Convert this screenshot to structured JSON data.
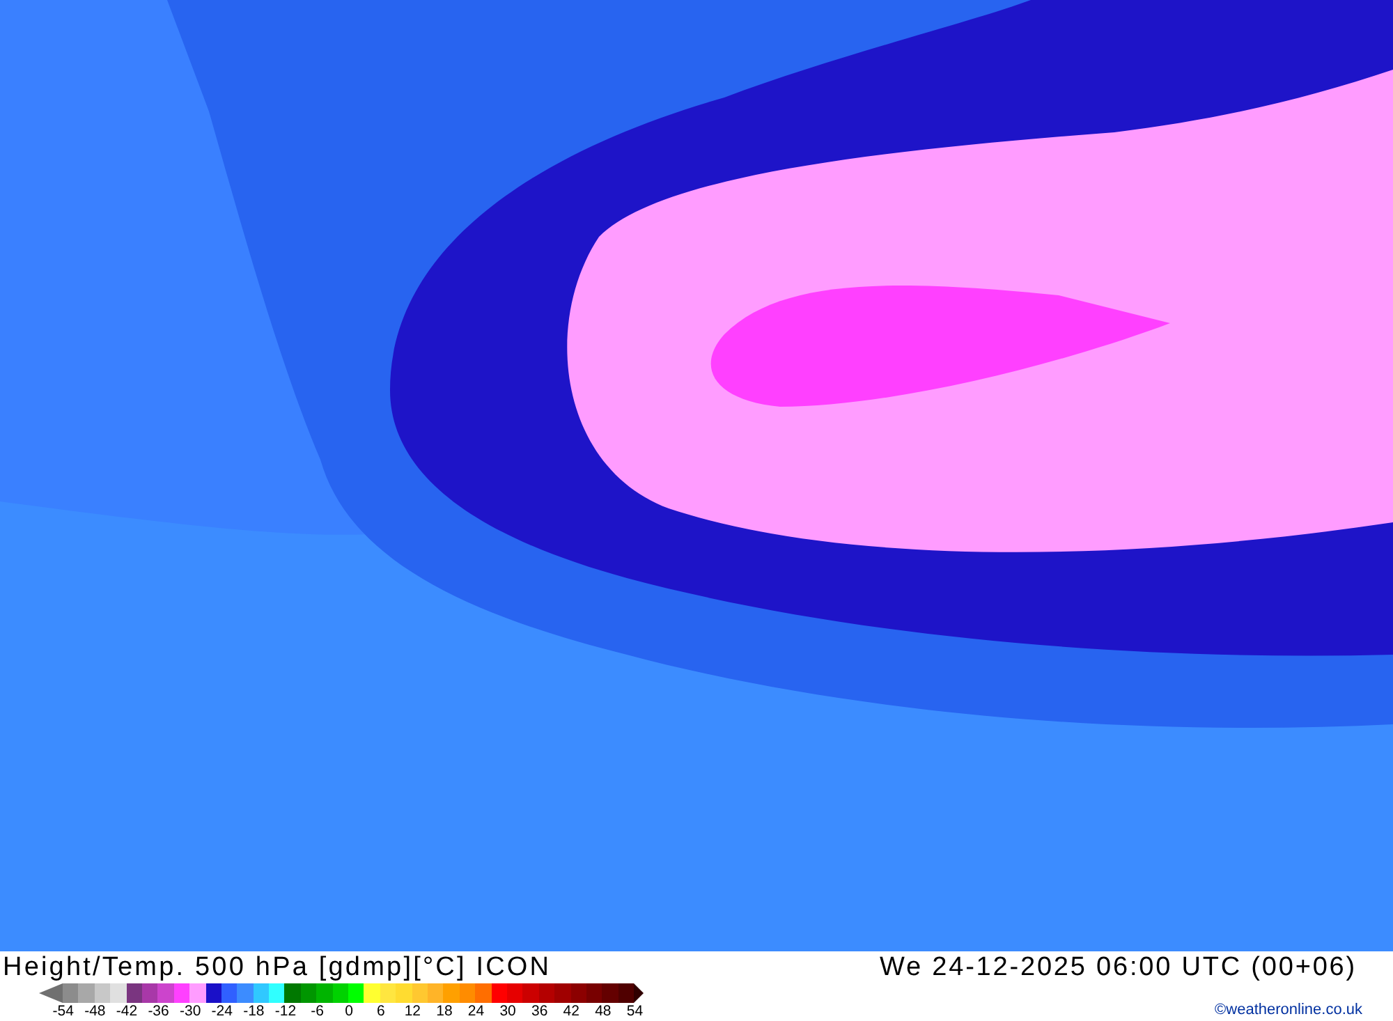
{
  "map": {
    "title": "Height/Temp. 500 hPa [gdmp][°C] ICON",
    "run": "We 24-12-2025 06:00 UTC (00+06)",
    "credit": "©weatheronline.co.uk"
  },
  "legend": {
    "swatches": [
      {
        "color": "#8c8c8c"
      },
      {
        "color": "#a8a8a8"
      },
      {
        "color": "#c8c8c8"
      },
      {
        "color": "#e0e0e0"
      },
      {
        "color": "#7a3580"
      },
      {
        "color": "#a838a8"
      },
      {
        "color": "#cc44cc"
      },
      {
        "color": "#ff40ff"
      },
      {
        "color": "#ff9cff"
      },
      {
        "color": "#1a10c8"
      },
      {
        "color": "#3060ff"
      },
      {
        "color": "#3c8cff"
      },
      {
        "color": "#30c8ff"
      },
      {
        "color": "#30ffff"
      },
      {
        "color": "#007800"
      },
      {
        "color": "#009600"
      },
      {
        "color": "#00b400"
      },
      {
        "color": "#00d200"
      },
      {
        "color": "#00ff00"
      },
      {
        "color": "#ffff30"
      },
      {
        "color": "#ffe640"
      },
      {
        "color": "#ffdc30"
      },
      {
        "color": "#ffc830"
      },
      {
        "color": "#ffb428"
      },
      {
        "color": "#ffa000"
      },
      {
        "color": "#ff8c00"
      },
      {
        "color": "#ff6e00"
      },
      {
        "color": "#ff0000"
      },
      {
        "color": "#e60000"
      },
      {
        "color": "#cc0000"
      },
      {
        "color": "#b40000"
      },
      {
        "color": "#a00000"
      },
      {
        "color": "#8c0000"
      },
      {
        "color": "#780000"
      },
      {
        "color": "#640000"
      },
      {
        "color": "#500000"
      }
    ],
    "ticks": [
      "-54",
      "-48",
      "-42",
      "-36",
      "-30",
      "-24",
      "-18",
      "-12",
      "-6",
      "0",
      "6",
      "12",
      "18",
      "24",
      "30",
      "36",
      "42",
      "48",
      "54"
    ]
  }
}
